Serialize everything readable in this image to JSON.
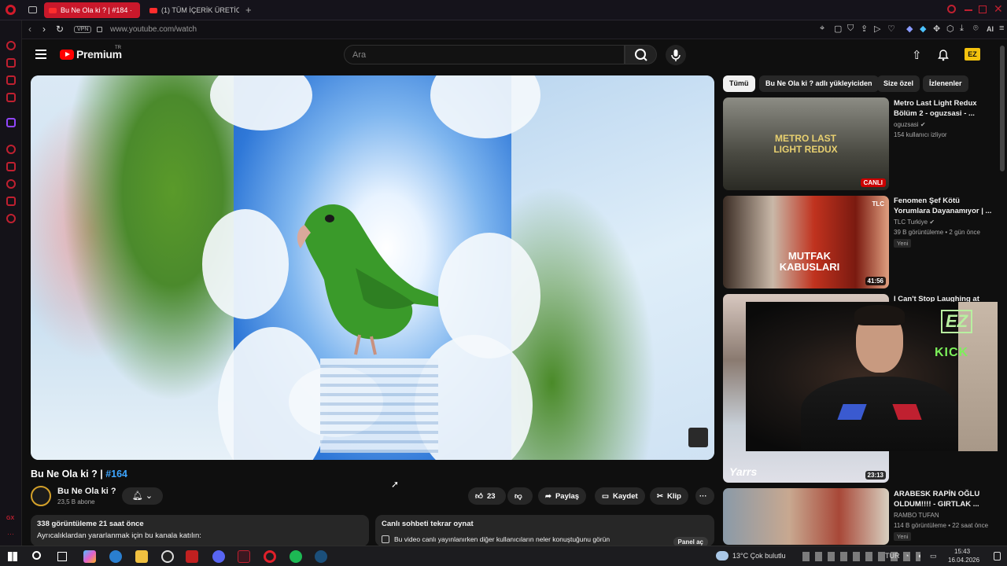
{
  "browser": {
    "tabs": [
      {
        "label": "Bu Ne Ola ki ? | #184 ·",
        "active": true
      },
      {
        "label": "(1) TÜM İÇERİK ÜRETİCİLE",
        "active": false
      }
    ],
    "new_tab": "+",
    "url": "www.youtube.com/watch",
    "vpn": "VPN",
    "ai_label": "AI"
  },
  "header": {
    "logo_text": "Premium",
    "logo_region": "TR",
    "search_placeholder": "Ara",
    "avatar_text": "EZ"
  },
  "video": {
    "title": "Bu Ne Ola ki ? |",
    "episode_tag": "#164",
    "channel_name": "Bu Ne Ola ki ?",
    "subscribers": "23,5 B abone",
    "likes": "23",
    "share_label": "Paylaş",
    "save_label": "Kaydet",
    "clip_label": "Klip",
    "more_label": "···"
  },
  "description": {
    "stats": "338 görüntüleme  21 saat önce",
    "line": "Ayrıcalıklardan yararlanmak için bu kanala katılın:"
  },
  "chat_replay": {
    "title": "Canlı sohbeti tekrar oynat",
    "line": "Bu video canlı yayınlanırken diğer kullanıcıların neler konuştuğunu görün",
    "button": "Panel aç"
  },
  "chips": [
    "Tümü",
    "Bu Ne Ola ki ? adlı yükleyiciden",
    "Size özel",
    "İzlenenler"
  ],
  "recommendations": [
    {
      "title": "Metro Last Light Redux Bölüm 2 - oguzsasi - ...",
      "channel": "oguzsasi",
      "meta": "154 kullanıcı izliyor",
      "badge": "CANLI",
      "thumb_text": "METRO LAST LIGHT REDUX"
    },
    {
      "title": "Fenomen Şef Kötü Yorumlara Dayanamıyor | ...",
      "channel": "TLC Turkiye",
      "meta": "39 B görüntüleme • 2 gün önce",
      "badge": "41:56",
      "tag": "Yeni",
      "thumb_text": "MUTFAK KABUSLARI",
      "thumb_logo": "TLC"
    },
    {
      "title": "I Can't Stop Laughing at",
      "badge": "23:13",
      "thumb_text": "Yarrs"
    },
    {
      "title": "ARABESK RAPİN OĞLU OLDUM!!!! - GIRTLAK ...",
      "channel": "RAMBO TUFAN",
      "meta": "114 B görüntüleme • 22 saat önce",
      "tag": "Yeni"
    }
  ],
  "webcam": {
    "overlay_1": "EZ",
    "overlay_2": "KICK"
  },
  "taskbar": {
    "weather": "13°C  Çok bulutlu",
    "lang": "TUR",
    "time": "15:43",
    "date": "16.04.2026"
  },
  "colors": {
    "accent_red": "#ff0000",
    "link_blue": "#3ea6ff",
    "opera_red": "#c9182b"
  }
}
